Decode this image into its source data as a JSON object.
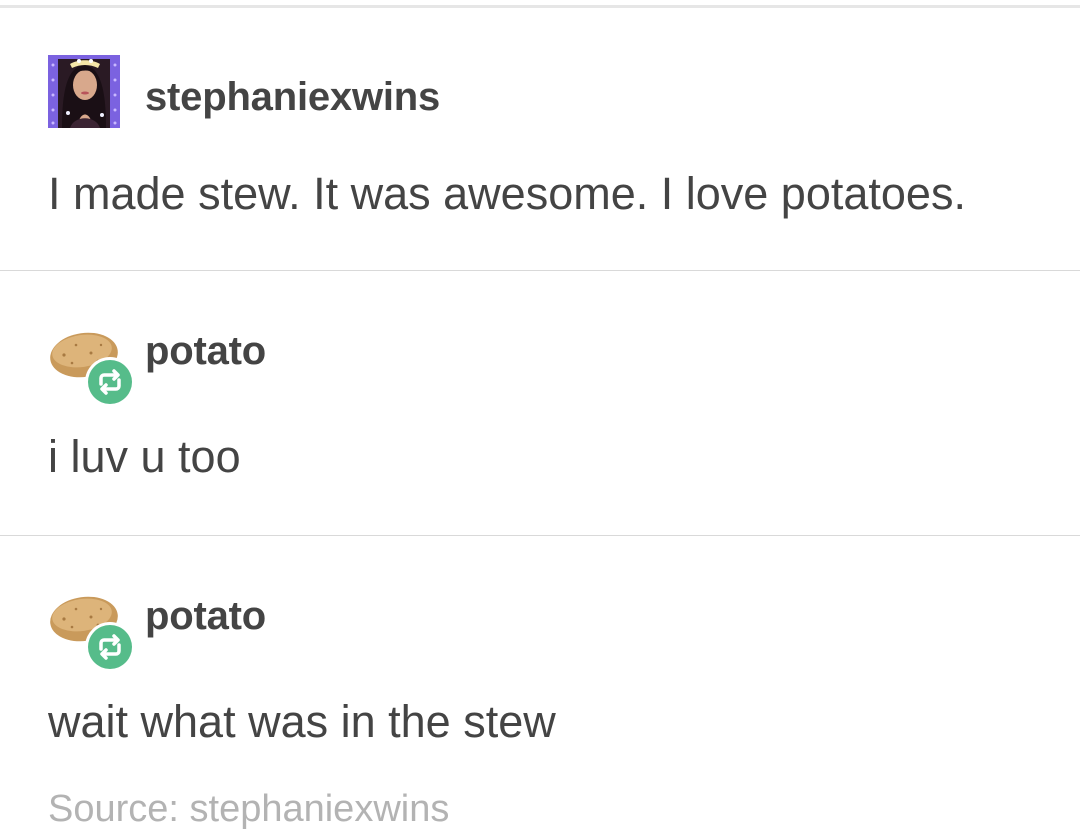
{
  "posts": [
    {
      "username": "stephaniexwins",
      "avatar": "profile-photo-avatar",
      "text": "I made stew. It was awesome. I love potatoes."
    },
    {
      "username": "potato",
      "avatar": "potato-icon",
      "badge": "reblog-icon",
      "text": "i luv u too"
    },
    {
      "username": "potato",
      "avatar": "potato-icon",
      "badge": "reblog-icon",
      "text": "wait what was in the stew"
    }
  ],
  "source": "Source: stephaniexwins",
  "colors": {
    "text": "#444444",
    "source_text": "#b3b3b3",
    "reblog_badge": "#56bc8a",
    "divider": "#d9d9d9",
    "avatar_frame": "#7b62e0"
  }
}
